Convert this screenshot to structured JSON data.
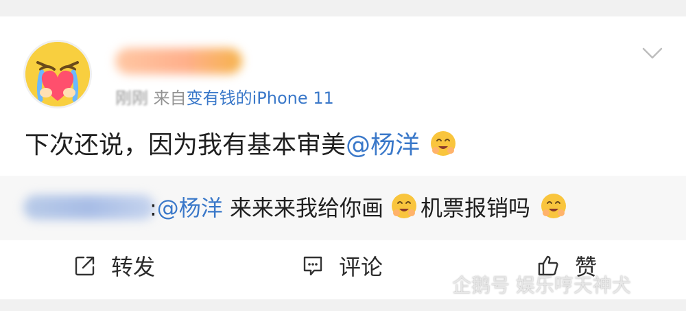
{
  "post": {
    "meta_time": "刚刚",
    "meta_from": "来自",
    "meta_source": "变有钱的iPhone 11",
    "content_text": "下次还说，因为我有基本审美",
    "content_mention": "@杨洋"
  },
  "repost": {
    "prefix": ":",
    "mention": "@杨洋",
    "text_1": " 来来来我给你画",
    "text_2": "机票报销吗"
  },
  "actions": {
    "repost": "转发",
    "comment": "评论",
    "like": "赞"
  },
  "watermark": {
    "text": "企鹅号 娱乐哼天神犬"
  },
  "icons": {
    "avatar": "crying-face-heart-avatar",
    "menu": "chevron-down-icon",
    "emoji": "blush-emoji",
    "repost": "share-icon",
    "comment": "comment-icon",
    "like": "thumbs-up-icon",
    "watermark": "penguin-icon"
  },
  "colors": {
    "link_blue": "#3a78c9",
    "text": "#1f1f1f",
    "meta": "#939393",
    "repost_bg": "#f7f7f7"
  }
}
